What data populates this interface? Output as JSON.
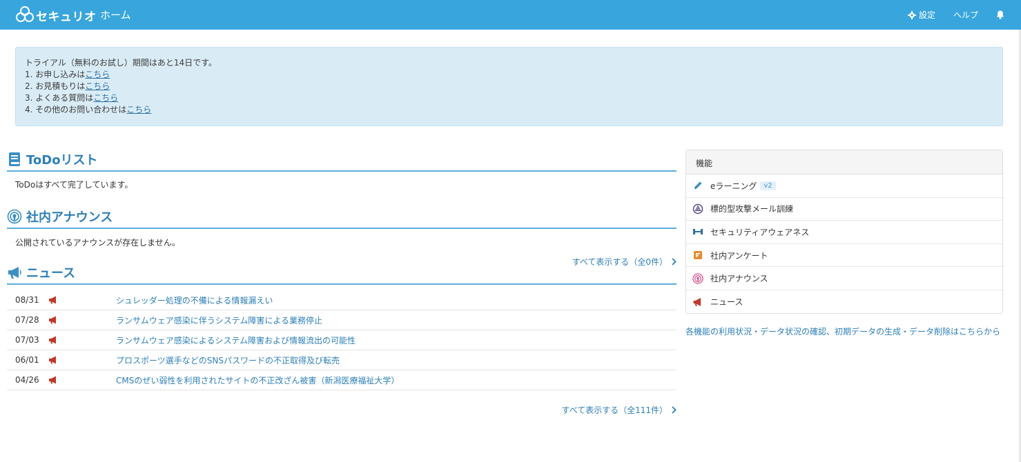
{
  "header": {
    "brand": "セキュリオ",
    "home": "ホーム",
    "settings": "設定",
    "help": "ヘルプ",
    "bg_color": "#38a6dd"
  },
  "alert": {
    "line1": "トライアル（無料のお試し）期間はあと14日です。",
    "items": [
      {
        "prefix": "1. お申し込みは",
        "link": "こちら"
      },
      {
        "prefix": "2. お見積もりは",
        "link": "こちら"
      },
      {
        "prefix": "3. よくある質問は",
        "link": "こちら"
      },
      {
        "prefix": "4. その他のお問い合わせは",
        "link": "こちら"
      }
    ]
  },
  "todo": {
    "title": "ToDoリスト",
    "empty": "ToDoはすべて完了しています。"
  },
  "announce": {
    "title": "社内アナウンス",
    "empty": "公開されているアナウンスが存在しません。"
  },
  "news": {
    "title": "ニュース",
    "show_all_top": "すべて表示する（全0件）",
    "show_all_bottom": "すべて表示する（全111件）",
    "rows": [
      {
        "date": "08/31",
        "title": "シュレッダー処理の不備による情報漏えい"
      },
      {
        "date": "07/28",
        "title": "ランサムウェア感染に伴うシステム障害による業務停止"
      },
      {
        "date": "07/03",
        "title": "ランサムウェア感染によるシステム障害および情報流出の可能性"
      },
      {
        "date": "06/01",
        "title": "プロスポーツ選手などのSNSパスワードの不正取得及び転売"
      },
      {
        "date": "04/26",
        "title": "CMSのぜい弱性を利用されたサイトの不正改ざん被害（新潟医療福祉大学）"
      }
    ]
  },
  "features": {
    "heading": "機能",
    "items": [
      {
        "label": "eラーニング",
        "badge": "v2",
        "icon": "pencil-icon"
      },
      {
        "label": "標的型攻撃メール訓練",
        "icon": "phishing-icon"
      },
      {
        "label": "セキュリティアウェアネス",
        "icon": "dumbbell-icon"
      },
      {
        "label": "社内アンケート",
        "icon": "survey-icon"
      },
      {
        "label": "社内アナウンス",
        "icon": "broadcast-icon"
      },
      {
        "label": "ニュース",
        "icon": "megaphone-icon"
      }
    ],
    "footer_link": "各機能の利用状況・データ状況の確認、初期データの生成・データ削除はこちらから"
  }
}
